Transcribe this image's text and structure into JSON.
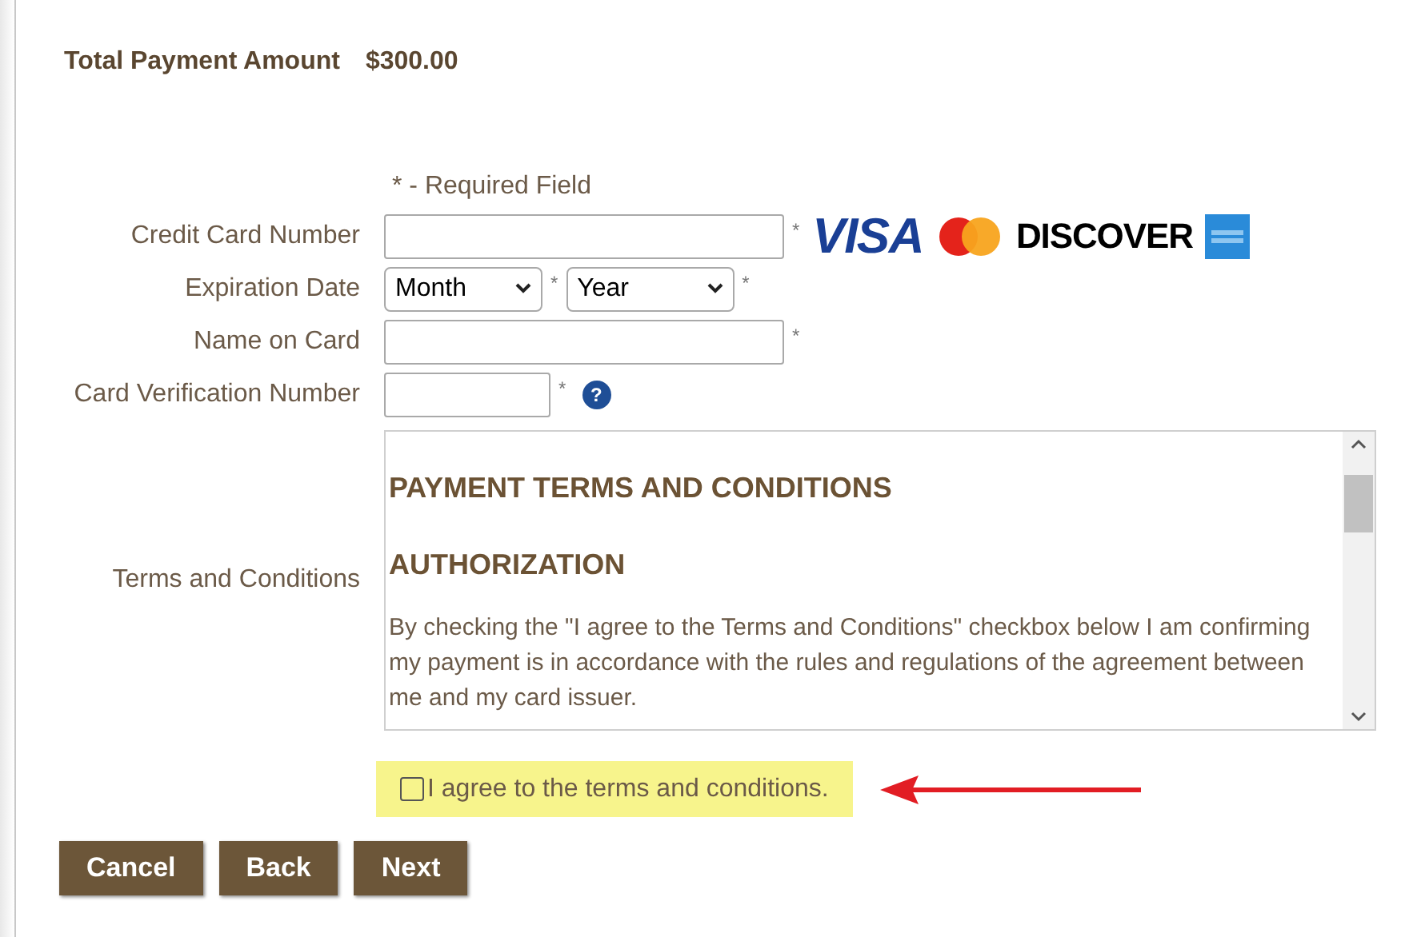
{
  "total": {
    "label": "Total Payment Amount",
    "value": "$300.00"
  },
  "required_note": "* - Required Field",
  "fields": [
    {
      "kind": "card_number",
      "label": "Credit Card Number",
      "required_mark": "*"
    },
    {
      "kind": "dates",
      "label": "Expiration Date",
      "selects": [
        {
          "value": "Month",
          "required_mark": "*"
        },
        {
          "value": "Year",
          "required_mark": "*"
        }
      ]
    },
    {
      "kind": "text",
      "label": "Name on Card",
      "required_mark": "*"
    },
    {
      "kind": "cvv",
      "label": "Card Verification Number",
      "required_mark": "*",
      "help": "?"
    }
  ],
  "card_logos": [
    {
      "kind": "visa",
      "text": "VISA"
    },
    {
      "kind": "mastercard"
    },
    {
      "kind": "discover",
      "text": "DISCOVER"
    },
    {
      "kind": "amex"
    }
  ],
  "terms": {
    "label": "Terms and Conditions",
    "heading": "PAYMENT TERMS AND CONDITIONS",
    "subheading": "AUTHORIZATION",
    "body": "By checking the \"I agree to the Terms and Conditions\" checkbox below I am confirming my payment is in accordance with the rules and regulations of the agreement between me and my card issuer."
  },
  "agree": {
    "label": "I agree to the terms and conditions.",
    "checked": false,
    "highlighted": true
  },
  "buttons": [
    "Cancel",
    "Back",
    "Next"
  ]
}
